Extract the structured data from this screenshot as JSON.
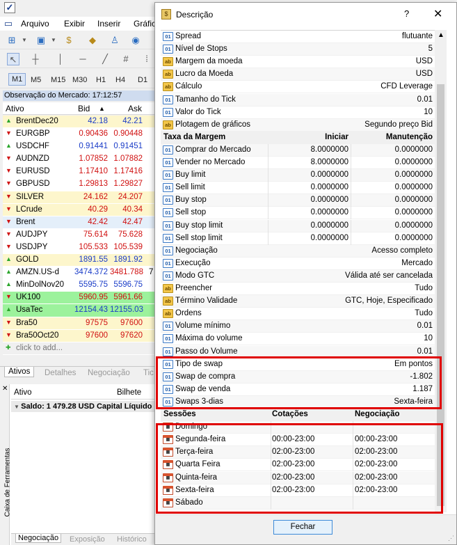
{
  "app": {
    "menu": [
      "Arquivo",
      "Exibir",
      "Inserir",
      "Gráfic"
    ],
    "timeframes": [
      "M1",
      "M5",
      "M15",
      "M30",
      "H1",
      "H4",
      "D1"
    ],
    "selected_timeframe": "M1"
  },
  "market_watch": {
    "header": "Observação do Mercado: 17:12:57",
    "columns": {
      "symbol": "Ativo",
      "bid": "Bid",
      "ask": "Ask"
    },
    "rows": [
      {
        "symbol": "BrentDec20",
        "bid": "42.18",
        "ask": "42.21",
        "dir": "up",
        "bg": "#fdf6cc",
        "bidColor": "#1a3cc8",
        "askColor": "#1a3cc8",
        "extra": ""
      },
      {
        "symbol": "EURGBP",
        "bid": "0.90436",
        "ask": "0.90448",
        "dir": "down",
        "bg": "#fff",
        "bidColor": "#d01010",
        "askColor": "#d01010",
        "extra": ""
      },
      {
        "symbol": "USDCHF",
        "bid": "0.91441",
        "ask": "0.91451",
        "dir": "up",
        "bg": "#fff",
        "bidColor": "#1a3cc8",
        "askColor": "#1a3cc8",
        "extra": ""
      },
      {
        "symbol": "AUDNZD",
        "bid": "1.07852",
        "ask": "1.07882",
        "dir": "down",
        "bg": "#fff",
        "bidColor": "#d01010",
        "askColor": "#d01010",
        "extra": ""
      },
      {
        "symbol": "EURUSD",
        "bid": "1.17410",
        "ask": "1.17416",
        "dir": "down",
        "bg": "#fff",
        "bidColor": "#d01010",
        "askColor": "#d01010",
        "extra": ""
      },
      {
        "symbol": "GBPUSD",
        "bid": "1.29813",
        "ask": "1.29827",
        "dir": "down",
        "bg": "#fff",
        "bidColor": "#d01010",
        "askColor": "#d01010",
        "extra": ""
      },
      {
        "symbol": "SILVER",
        "bid": "24.162",
        "ask": "24.207",
        "dir": "down",
        "bg": "#fdf6cc",
        "bidColor": "#d01010",
        "askColor": "#d01010",
        "extra": ""
      },
      {
        "symbol": "LCrude",
        "bid": "40.29",
        "ask": "40.34",
        "dir": "down",
        "bg": "#fdf6cc",
        "bidColor": "#d01010",
        "askColor": "#d01010",
        "extra": ""
      },
      {
        "symbol": "Brent",
        "bid": "42.42",
        "ask": "42.47",
        "dir": "down",
        "bg": "#e4effa",
        "bidColor": "#d01010",
        "askColor": "#d01010",
        "extra": ""
      },
      {
        "symbol": "AUDJPY",
        "bid": "75.614",
        "ask": "75.628",
        "dir": "down",
        "bg": "#fff",
        "bidColor": "#d01010",
        "askColor": "#d01010",
        "extra": ""
      },
      {
        "symbol": "USDJPY",
        "bid": "105.533",
        "ask": "105.539",
        "dir": "down",
        "bg": "#fff",
        "bidColor": "#d01010",
        "askColor": "#d01010",
        "extra": ""
      },
      {
        "symbol": "GOLD",
        "bid": "1891.55",
        "ask": "1891.92",
        "dir": "up",
        "bg": "#fdf6cc",
        "bidColor": "#1a3cc8",
        "askColor": "#1a3cc8",
        "extra": ""
      },
      {
        "symbol": "AMZN.US-d",
        "bid": "3474.372",
        "ask": "3481.788",
        "dir": "up",
        "bg": "#fff",
        "bidColor": "#1a3cc8",
        "askColor": "#d01010",
        "extra": "7"
      },
      {
        "symbol": "MinDolNov20",
        "bid": "5595.75",
        "ask": "5596.75",
        "dir": "up",
        "bg": "#fff",
        "bidColor": "#1a3cc8",
        "askColor": "#1a3cc8",
        "extra": ""
      },
      {
        "symbol": "UK100",
        "bid": "5960.95",
        "ask": "5961.66",
        "dir": "down",
        "bg": "#9cf29c",
        "bidColor": "#d01010",
        "askColor": "#d01010",
        "extra": ""
      },
      {
        "symbol": "UsaTec",
        "bid": "12154.43",
        "ask": "12155.03",
        "dir": "up",
        "bg": "#9cf29c",
        "bidColor": "#1a3cc8",
        "askColor": "#1a3cc8",
        "extra": ""
      },
      {
        "symbol": "Bra50",
        "bid": "97575",
        "ask": "97600",
        "dir": "down",
        "bg": "#fdf6cc",
        "bidColor": "#d01010",
        "askColor": "#d01010",
        "extra": ""
      },
      {
        "symbol": "Bra50Oct20",
        "bid": "97600",
        "ask": "97620",
        "dir": "down",
        "bg": "#fdf6cc",
        "bidColor": "#d01010",
        "askColor": "#d01010",
        "extra": ""
      }
    ],
    "add_row": "click to add...",
    "tabs": [
      "Ativos",
      "Detalhes",
      "Negociação",
      "Tic"
    ]
  },
  "toolbox": {
    "vertical_label": "Caixa de Ferramentas",
    "columns": {
      "asset": "Ativo",
      "ticket": "Bilhete"
    },
    "balance": "Saldo: 1 479.28 USD  Capital Líquido",
    "tabs": [
      "Negociação",
      "Exposição",
      "Histórico"
    ]
  },
  "dialog": {
    "title": "Descrição",
    "help": "?",
    "close_label": "Fechar",
    "props": [
      {
        "icon": "n",
        "label": "Spread",
        "value": "flutuante"
      },
      {
        "icon": "n",
        "label": "Nível de Stops",
        "value": "5"
      },
      {
        "icon": "t",
        "label": "Margem da moeda",
        "value": "USD"
      },
      {
        "icon": "t",
        "label": "Lucro da Moeda",
        "value": "USD"
      },
      {
        "icon": "t",
        "label": "Cálculo",
        "value": "CFD Leverage"
      },
      {
        "icon": "n",
        "label": "Tamanho do Tick",
        "value": "0.01"
      },
      {
        "icon": "n",
        "label": "Valor do Tick",
        "value": "10"
      },
      {
        "icon": "t",
        "label": "Plotagem de gráficos",
        "value": "Segundo preço Bid"
      }
    ],
    "margin_header": {
      "label": "Taxa da Margem",
      "initial": "Iniciar",
      "maintenance": "Manutenção"
    },
    "margins": [
      {
        "label": "Comprar do Mercado",
        "initial": "8.0000000",
        "maintenance": "0.0000000"
      },
      {
        "label": "Vender no Mercado",
        "initial": "8.0000000",
        "maintenance": "0.0000000"
      },
      {
        "label": "Buy limit",
        "initial": "0.0000000",
        "maintenance": "0.0000000"
      },
      {
        "label": "Sell limit",
        "initial": "0.0000000",
        "maintenance": "0.0000000"
      },
      {
        "label": "Buy stop",
        "initial": "0.0000000",
        "maintenance": "0.0000000"
      },
      {
        "label": "Sell stop",
        "initial": "0.0000000",
        "maintenance": "0.0000000"
      },
      {
        "label": "Buy stop limit",
        "initial": "0.0000000",
        "maintenance": "0.0000000"
      },
      {
        "label": "Sell stop limit",
        "initial": "0.0000000",
        "maintenance": "0.0000000"
      }
    ],
    "props2": [
      {
        "icon": "n",
        "label": "Negociação",
        "value": "Acesso completo"
      },
      {
        "icon": "n",
        "label": "Execução",
        "value": "Mercado"
      },
      {
        "icon": "n",
        "label": "Modo GTC",
        "value": "Válida até ser cancelada"
      },
      {
        "icon": "t",
        "label": "Preencher",
        "value": "Tudo"
      },
      {
        "icon": "t",
        "label": "Término Validade",
        "value": "GTC, Hoje, Especificado"
      },
      {
        "icon": "t",
        "label": "Ordens",
        "value": "Tudo"
      },
      {
        "icon": "n",
        "label": "Volume mínimo",
        "value": "0.01"
      },
      {
        "icon": "n",
        "label": "Máxima do volume",
        "value": "10"
      },
      {
        "icon": "n",
        "label": "Passo do Volume",
        "value": "0.01"
      },
      {
        "icon": "n",
        "label": "Tipo de swap",
        "value": "Em pontos"
      },
      {
        "icon": "n",
        "label": "Swap de compra",
        "value": "-1.802"
      },
      {
        "icon": "n",
        "label": "Swap de venda",
        "value": "1.187"
      },
      {
        "icon": "n",
        "label": "Swaps 3-dias",
        "value": "Sexta-feira"
      }
    ],
    "sessions_header": {
      "label": "Sessões",
      "quotes": "Cotações",
      "trading": "Negociação"
    },
    "sessions": [
      {
        "day": "Domingo",
        "quotes": "",
        "trading": ""
      },
      {
        "day": "Segunda-feira",
        "quotes": "00:00-23:00",
        "trading": "00:00-23:00"
      },
      {
        "day": "Terça-feira",
        "quotes": "02:00-23:00",
        "trading": "02:00-23:00"
      },
      {
        "day": "Quarta Feira",
        "quotes": "02:00-23:00",
        "trading": "02:00-23:00"
      },
      {
        "day": "Quinta-feira",
        "quotes": "02:00-23:00",
        "trading": "02:00-23:00"
      },
      {
        "day": "Sexta-feira",
        "quotes": "02:00-23:00",
        "trading": "02:00-23:00"
      },
      {
        "day": "Sábado",
        "quotes": "",
        "trading": ""
      }
    ]
  },
  "colors": {
    "highlight_border": "#e00000",
    "button_border": "#3c8ad8",
    "header_bg": "#cfdcef"
  }
}
